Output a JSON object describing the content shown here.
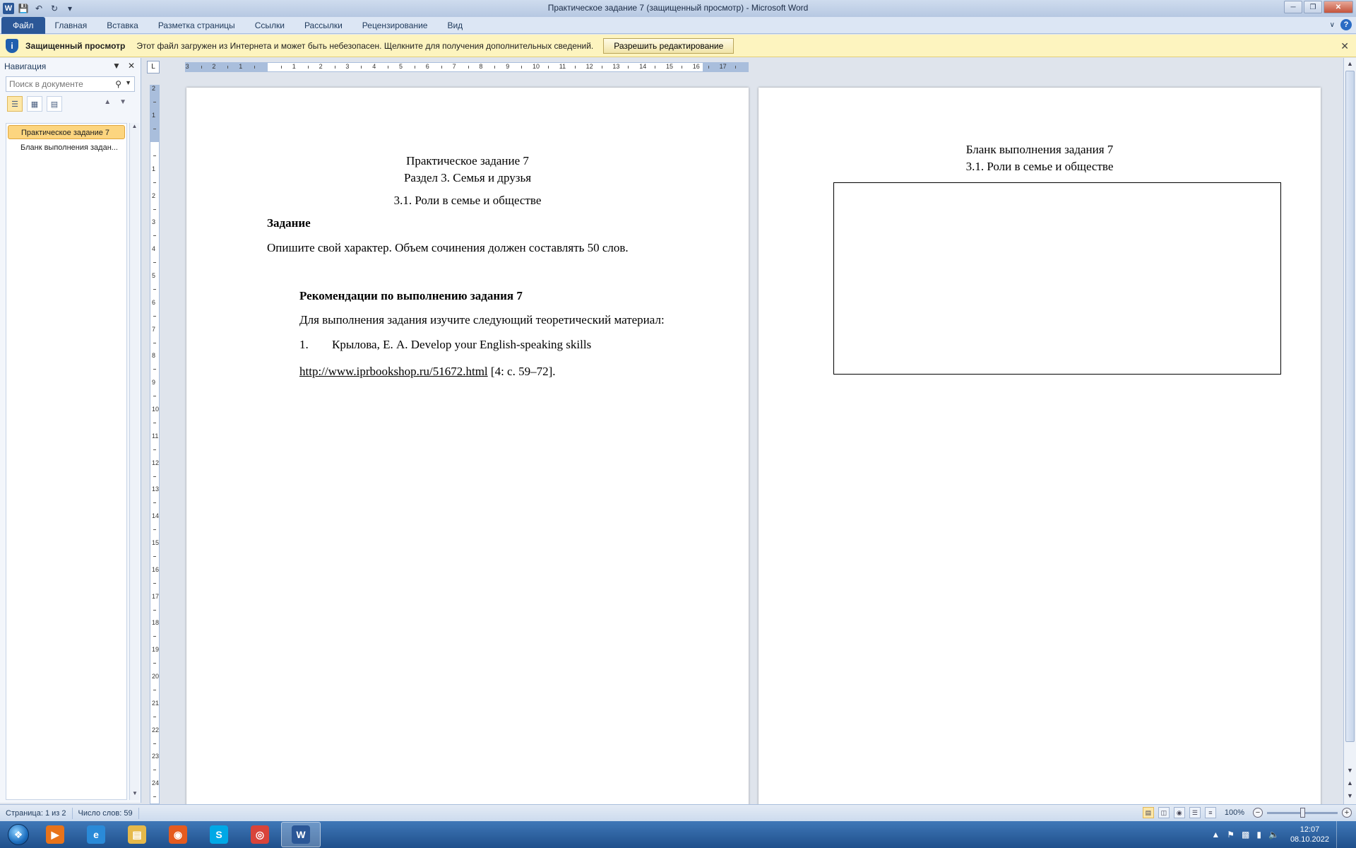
{
  "window": {
    "title": "Практическое задание 7 (защищенный просмотр)  -  Microsoft Word",
    "logo": "W",
    "qat": [
      "save-icon",
      "undo-icon",
      "redo-icon",
      "customize-icon"
    ],
    "controls": [
      "minimize-icon",
      "restore-icon",
      "close-icon"
    ]
  },
  "ribbon": {
    "tabs": [
      "Файл",
      "Главная",
      "Вставка",
      "Разметка страницы",
      "Ссылки",
      "Рассылки",
      "Рецензирование",
      "Вид"
    ],
    "help_icon": "?"
  },
  "protected_view": {
    "title": "Защищенный просмотр",
    "message": "Этот файл загружен из Интернета и может быть небезопасен. Щелкните для получения дополнительных сведений.",
    "button": "Разрешить редактирование",
    "icon": "shield-icon"
  },
  "navigation": {
    "title": "Навигация",
    "search_placeholder": "Поиск в документе",
    "items": [
      "Практическое задание 7",
      "Бланк выполнения задан..."
    ],
    "active_index": 0
  },
  "page1": {
    "title1": "Практическое задание 7",
    "title2": "Раздел 3. Семья и друзья",
    "subtitle": "3.1. Роли в семье и обществе",
    "task_heading": "Задание",
    "task_text": "Опишите свой характер. Объем сочинения должен составлять 50 слов.",
    "rec_heading": "Рекомендации по выполнению задания 7",
    "rec_text": "Для выполнения задания изучите следующий теоретический материал:",
    "list_number": "1.",
    "list_text": "Крылова, Е. А. Develop your English-speaking skills",
    "link": "http://www.iprbookshop.ru/51672.html",
    "link_suffix": " [4: с. 59–72]."
  },
  "page2": {
    "title": "Бланк выполнения задания 7",
    "subtitle": "3.1. Роли в семье и обществе"
  },
  "status": {
    "page": "Страница: 1 из 2",
    "words": "Число слов: 59",
    "zoom": "100%",
    "zoom_value_percent": 100
  },
  "taskbar": {
    "apps": [
      {
        "name": "media-player-icon",
        "color": "#e8731a",
        "glyph": "▶"
      },
      {
        "name": "internet-explorer-icon",
        "color": "#2a8ad8",
        "glyph": "e"
      },
      {
        "name": "file-explorer-icon",
        "color": "#e6b94a",
        "glyph": "▤"
      },
      {
        "name": "firefox-icon",
        "color": "#e55b1f",
        "glyph": "◉"
      },
      {
        "name": "skype-icon",
        "color": "#00a8e6",
        "glyph": "S"
      },
      {
        "name": "chrome-icon",
        "color": "#d9443a",
        "glyph": "◎"
      },
      {
        "name": "word-icon",
        "color": "#2b5797",
        "glyph": "W"
      }
    ],
    "active_app": 6,
    "time": "12:07",
    "date": "08.10.2022"
  }
}
